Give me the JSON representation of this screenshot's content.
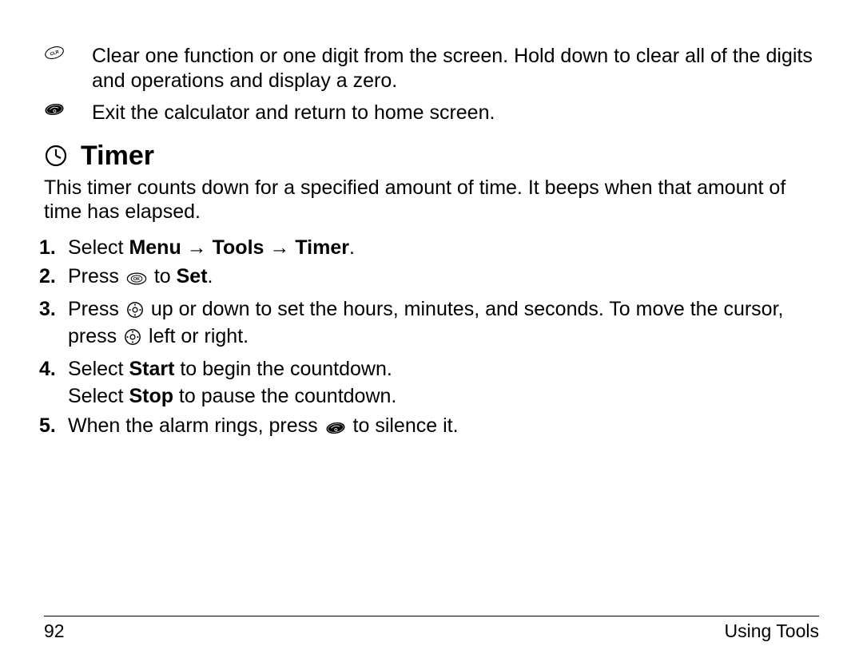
{
  "rows": [
    {
      "icon": "clr",
      "text": "Clear one function or one digit from the screen. Hold down to clear all of the digits and operations and display a zero."
    },
    {
      "icon": "end",
      "text": "Exit the calculator and return to home screen."
    }
  ],
  "heading": "Timer",
  "intro": "This timer counts down for a specified amount of time. It beeps when that amount of time has elapsed.",
  "steps": {
    "s1_a": "Select ",
    "s1_b": "Menu",
    "s1_c": "Tools",
    "s1_d": "Timer",
    "s2_a": "Press ",
    "s2_b": " to ",
    "s2_c": "Set",
    "s3_a": "Press ",
    "s3_b": " up or down to set the hours, minutes, and seconds. To move the cursor, press ",
    "s3_c": " left or right.",
    "s4_a": "Select ",
    "s4_b": "Start",
    "s4_c": " to begin the countdown.",
    "s4_d": "Select ",
    "s4_e": "Stop",
    "s4_f": " to pause the countdown.",
    "s5_a": "When the alarm rings, press ",
    "s5_b": " to silence it."
  },
  "arrow": "→",
  "footer": {
    "page": "92",
    "section": "Using Tools"
  }
}
